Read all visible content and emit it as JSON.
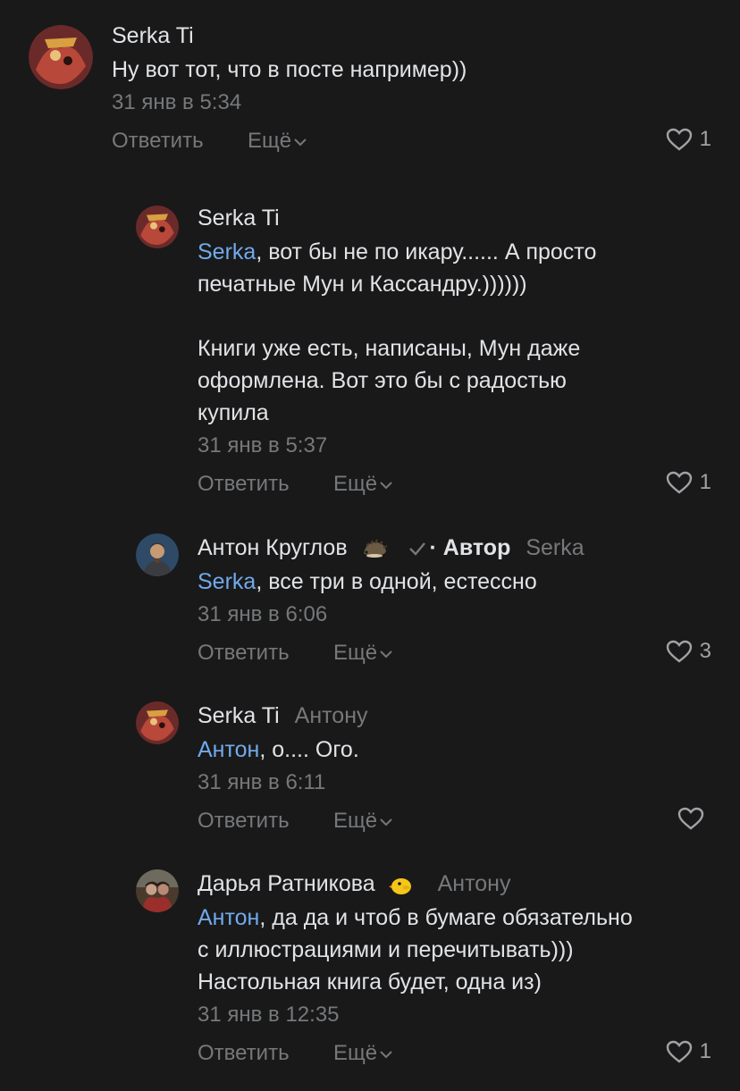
{
  "actions": {
    "reply": "Ответить",
    "more": "Ещё"
  },
  "comments": [
    {
      "author": "Serka Ti",
      "text": "Ну вот тот, что в посте например))",
      "time": "31 янв в 5:34",
      "likes": "1"
    },
    {
      "author": "Serka Ti",
      "mention": "Serka",
      "text1a": ", вот бы не по икару...... А просто",
      "text1b": "печатные Мун и Кассандру.))))))",
      "text2a": "Книги уже есть, написаны, Мун даже",
      "text2b": "оформлена. Вот это бы с радостью",
      "text2c": "купила",
      "time": "31 янв в 5:37",
      "likes": "1"
    },
    {
      "author": "Антон Круглов",
      "author_badge": "· Автор",
      "reply_to": "Serka",
      "mention": "Serka",
      "text": ", все три в одной, естессно",
      "time": "31 янв в 6:06",
      "likes": "3"
    },
    {
      "author": "Serka Ti",
      "reply_to": "Антону",
      "mention": "Антон",
      "text": ", о.... Ого.",
      "time": "31 янв в 6:11",
      "likes": ""
    },
    {
      "author": "Дарья Ратникова",
      "reply_to": "Антону",
      "mention": "Антон",
      "text1": ", да да и чтоб в бумаге обязательно",
      "text2": "с иллюстрациями и перечитывать)))",
      "text3": "Настольная книга будет, одна из)",
      "time": "31 янв в 12:35",
      "likes": "1"
    }
  ],
  "colors": {
    "background": "#19191a",
    "text": "#e1e3e6",
    "secondary": "#76787a",
    "link": "#71aaeb"
  }
}
